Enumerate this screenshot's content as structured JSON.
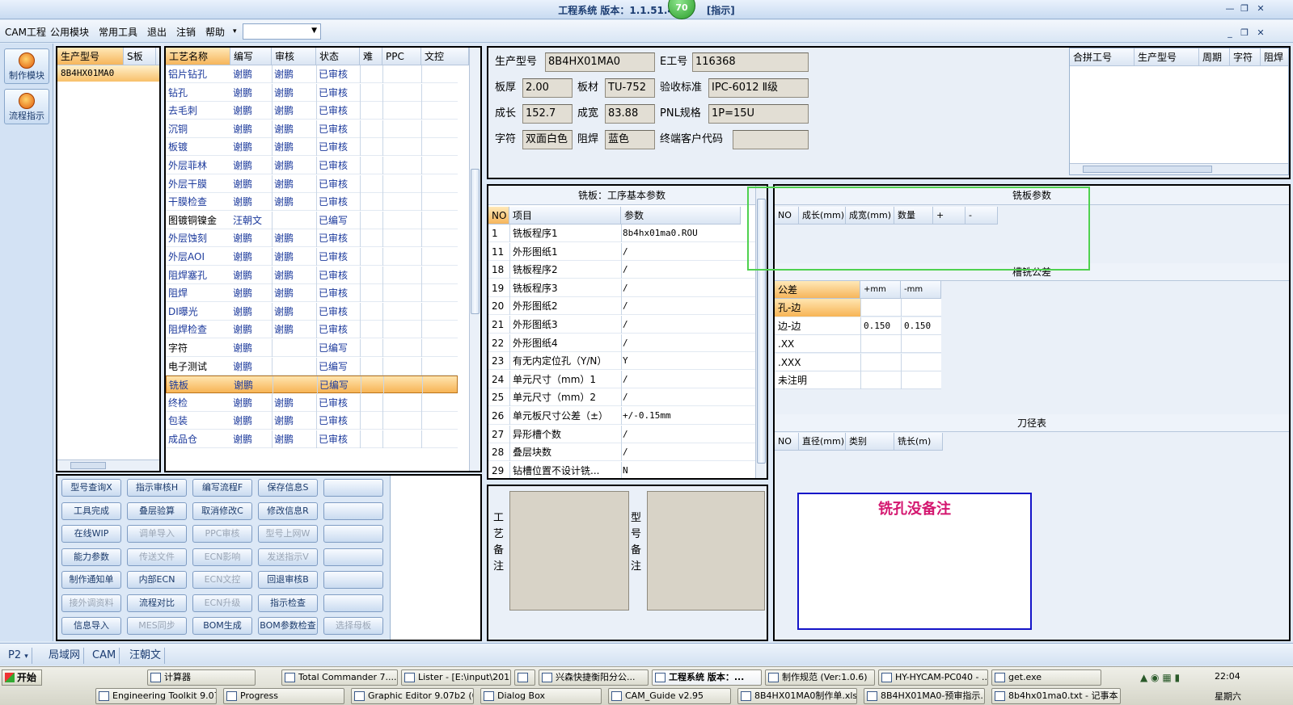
{
  "window": {
    "title": "工程系统   版本：1.1.51.4",
    "title_tail": "[指示]",
    "badge": "70"
  },
  "menu": {
    "items": [
      "CAM工程",
      "公用模块",
      "常用工具",
      "退出",
      "注销",
      "帮助"
    ],
    "dropdown_value": ""
  },
  "left_toolbar": {
    "buttons": [
      "制作模块",
      "流程指示"
    ]
  },
  "model_list": {
    "headers": [
      "生产型号",
      "S板",
      "E"
    ],
    "rows": [
      "8B4HX01MA0"
    ]
  },
  "process_table": {
    "headers": [
      "工艺名称",
      "编写",
      "审核",
      "状态",
      "难",
      "PPC",
      "文控"
    ],
    "selected_index": 17,
    "rows": [
      [
        "铝片钻孔",
        "谢鹏",
        "谢鹏",
        "已审核"
      ],
      [
        "钻孔",
        "谢鹏",
        "谢鹏",
        "已审核"
      ],
      [
        "去毛刺",
        "谢鹏",
        "谢鹏",
        "已审核"
      ],
      [
        "沉铜",
        "谢鹏",
        "谢鹏",
        "已审核"
      ],
      [
        "板镀",
        "谢鹏",
        "谢鹏",
        "已审核"
      ],
      [
        "外层菲林",
        "谢鹏",
        "谢鹏",
        "已审核"
      ],
      [
        "外层干膜",
        "谢鹏",
        "谢鹏",
        "已审核"
      ],
      [
        "干膜检查",
        "谢鹏",
        "谢鹏",
        "已审核"
      ],
      [
        "图镀铜镍金",
        "汪朝文",
        "",
        "已编写"
      ],
      [
        "外层蚀刻",
        "谢鹏",
        "谢鹏",
        "已审核"
      ],
      [
        "外层AOI",
        "谢鹏",
        "谢鹏",
        "已审核"
      ],
      [
        "阻焊塞孔",
        "谢鹏",
        "谢鹏",
        "已审核"
      ],
      [
        "阻焊",
        "谢鹏",
        "谢鹏",
        "已审核"
      ],
      [
        "DI曝光",
        "谢鹏",
        "谢鹏",
        "已审核"
      ],
      [
        "阻焊检查",
        "谢鹏",
        "谢鹏",
        "已审核"
      ],
      [
        "字符",
        "谢鹏",
        "",
        "已编写"
      ],
      [
        "电子测试",
        "谢鹏",
        "",
        "已编写"
      ],
      [
        "铣板",
        "谢鹏",
        "",
        "已编写"
      ],
      [
        "终检",
        "谢鹏",
        "谢鹏",
        "已审核"
      ],
      [
        "包装",
        "谢鹏",
        "谢鹏",
        "已审核"
      ],
      [
        "成品仓",
        "谢鹏",
        "谢鹏",
        "已审核"
      ]
    ]
  },
  "action_buttons": [
    [
      {
        "label": "型号查询X",
        "enabled": true
      },
      {
        "label": "指示审核H",
        "enabled": true
      },
      {
        "label": "编写流程F",
        "enabled": true
      },
      {
        "label": "保存信息S",
        "enabled": true
      },
      {
        "label": "",
        "enabled": true
      }
    ],
    [
      {
        "label": "工具完成",
        "enabled": true
      },
      {
        "label": "叠层验算",
        "enabled": true
      },
      {
        "label": "取消修改C",
        "enabled": true
      },
      {
        "label": "修改信息R",
        "enabled": true
      },
      {
        "label": "",
        "enabled": true
      }
    ],
    [
      {
        "label": "在线WIP",
        "enabled": true
      },
      {
        "label": "调单导入",
        "enabled": false
      },
      {
        "label": "PPC审核",
        "enabled": false
      },
      {
        "label": "型号上网W",
        "enabled": false
      },
      {
        "label": "",
        "enabled": true
      }
    ],
    [
      {
        "label": "能力参数",
        "enabled": true
      },
      {
        "label": "传送文件",
        "enabled": false
      },
      {
        "label": "ECN影响",
        "enabled": false
      },
      {
        "label": "发送指示V",
        "enabled": false
      },
      {
        "label": "",
        "enabled": true
      }
    ],
    [
      {
        "label": "制作通知单",
        "enabled": true
      },
      {
        "label": "内部ECN",
        "enabled": true
      },
      {
        "label": "ECN文控",
        "enabled": false
      },
      {
        "label": "回退审核B",
        "enabled": true
      },
      {
        "label": "",
        "enabled": true
      }
    ],
    [
      {
        "label": "接外调资料",
        "enabled": false
      },
      {
        "label": "流程对比",
        "enabled": true
      },
      {
        "label": "ECN升级",
        "enabled": false
      },
      {
        "label": "指示检查",
        "enabled": true
      },
      {
        "label": "",
        "enabled": true
      }
    ],
    [
      {
        "label": "信息导入",
        "enabled": true
      },
      {
        "label": "MES同步",
        "enabled": false
      },
      {
        "label": "BOM生成",
        "enabled": true
      },
      {
        "label": "BOM参数检查",
        "enabled": true
      },
      {
        "label": "选择母板",
        "enabled": false
      }
    ]
  ],
  "info": {
    "prod_model_label": "生产型号",
    "prod_model": "8B4HX01MA0",
    "e_no_label": "E工号",
    "e_no": "116368",
    "thickness_label": "板厚",
    "thickness": "2.00",
    "material_label": "板材",
    "material": "TU-752",
    "standard_label": "验收标准",
    "standard": "IPC-6012 Ⅱ级",
    "length_label": "成长",
    "length": "152.7",
    "width_label": "成宽",
    "width": "83.88",
    "pnl_label": "PNL规格",
    "pnl": "1P=15U",
    "char_label": "字符",
    "char": "双面白色",
    "mask_label": "阻焊",
    "mask": "蓝色",
    "customer_label": "终端客户代码",
    "customer": ""
  },
  "combine_table": {
    "headers": [
      "合拼工号",
      "生产型号",
      "周期",
      "字符",
      "阻焊"
    ]
  },
  "params": {
    "title": "铣板：工序基本参数",
    "headers": [
      "NO",
      "项目",
      "参数"
    ],
    "rows": [
      [
        "1",
        "铣板程序1",
        "8b4hx01ma0.ROU"
      ],
      [
        "11",
        "外形图纸1",
        "/"
      ],
      [
        "18",
        "铣板程序2",
        "/"
      ],
      [
        "19",
        "铣板程序3",
        "/"
      ],
      [
        "20",
        "外形图纸2",
        "/"
      ],
      [
        "21",
        "外形图纸3",
        "/"
      ],
      [
        "22",
        "外形图纸4",
        "/"
      ],
      [
        "23",
        "有无内定位孔（Y/N）",
        "Y"
      ],
      [
        "24",
        "单元尺寸（mm）1",
        "/"
      ],
      [
        "25",
        "单元尺寸（mm）2",
        "/"
      ],
      [
        "26",
        "单元板尺寸公差（±）",
        "+/-0.15mm"
      ],
      [
        "27",
        "异形槽个数",
        "/"
      ],
      [
        "28",
        "叠层块数",
        "/"
      ],
      [
        "29",
        "钻槽位置不设计铣...",
        "N"
      ]
    ]
  },
  "mill_params": {
    "title": "铣板参数",
    "headers": [
      "NO",
      "成长(mm)",
      "成宽(mm)",
      "数量",
      "+",
      "-"
    ]
  },
  "slot_tol": {
    "title": "槽铣公差",
    "headers": [
      "公差",
      "+mm",
      "-mm"
    ],
    "rows": [
      [
        "孔-边",
        "",
        ""
      ],
      [
        "边-边",
        "0.150",
        "0.150"
      ],
      [
        ".XX",
        "",
        ""
      ],
      [
        ".XXX",
        "",
        ""
      ],
      [
        "未注明",
        "",
        ""
      ]
    ]
  },
  "tool_table": {
    "title": "刀径表",
    "headers": [
      "NO",
      "直径(mm)",
      "类别",
      "铣长(m)"
    ]
  },
  "remarks": {
    "process_label": "工艺备注",
    "model_label": "型号备注"
  },
  "note": {
    "text": "铣孔没备注",
    "color": "#d4166f"
  },
  "bottom_tabs": {
    "p2": "P2",
    "items": [
      "局域网",
      "CAM",
      "汪朝文"
    ]
  },
  "taskbar": {
    "start": "开始",
    "row1": [
      "计算器",
      "Total Commander 7....",
      "Lister - [E:\\input\\201...",
      "",
      "兴森快捷衡阳分公...",
      "工程系统  版本：...",
      "制作规范 (Ver:1.0.6)",
      "HY-HYCAM-PC040 - ...",
      "get.exe"
    ],
    "row2": [
      "Engineering Toolkit 9.07...",
      "Progress",
      "Graphic Editor 9.07b2 (0...",
      "Dialog Box",
      "CAM_Guide v2.95",
      "8B4HX01MA0制作单.xls...",
      "8B4HX01MA0-预审指示...",
      "8b4hx01ma0.txt - 记事本"
    ],
    "time": "22:04",
    "day": "星期六"
  }
}
